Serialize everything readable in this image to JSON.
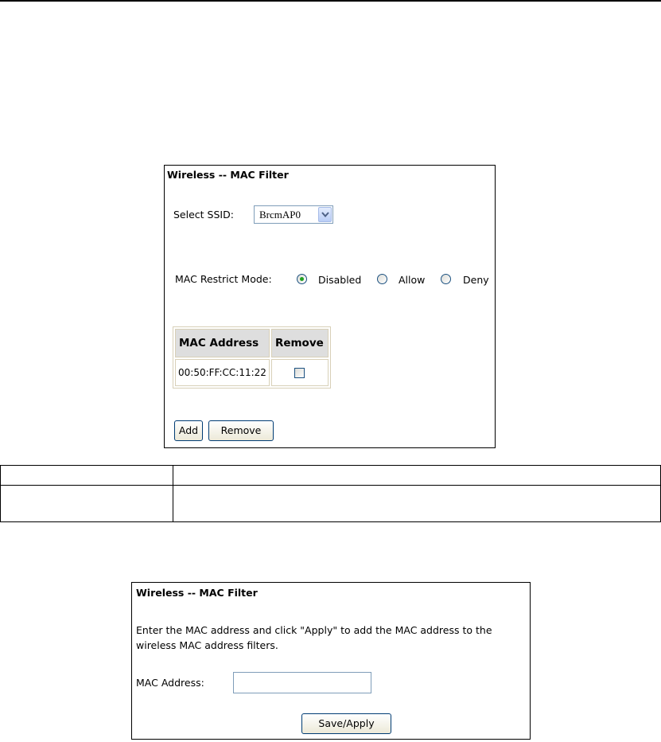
{
  "filter_panel": {
    "title": "Wireless -- MAC Filter",
    "ssid_label": "Select SSID:",
    "ssid_value": "BrcmAP0",
    "mode_label": "MAC Restrict Mode:",
    "modes": [
      {
        "label": "Disabled",
        "checked": true
      },
      {
        "label": "Allow",
        "checked": false
      },
      {
        "label": "Deny",
        "checked": false
      }
    ],
    "table": {
      "headers": [
        "MAC Address",
        "Remove"
      ],
      "rows": [
        {
          "mac": "00:50:FF:CC:11:22",
          "remove": false
        }
      ]
    },
    "add_label": "Add",
    "remove_label": "Remove"
  },
  "description_table": {
    "rows": [
      [
        "",
        ""
      ],
      [
        "",
        ""
      ]
    ]
  },
  "add_panel": {
    "title": "Wireless -- MAC Filter",
    "instruction": "Enter the MAC address and click \"Apply\" to add the MAC address to the wireless MAC address filters.",
    "instruction_line1": "Enter the MAC address and click \"Apply\" to add the MAC address to the",
    "instruction_line2": "wireless MAC address filters.",
    "mac_label": "MAC Address:",
    "mac_value": "",
    "save_label": "Save/Apply"
  },
  "colors": {
    "radio_checked": "#21a121",
    "header_bg": "#dedede",
    "button_border": "#003c74",
    "input_border": "#7f9db9"
  }
}
